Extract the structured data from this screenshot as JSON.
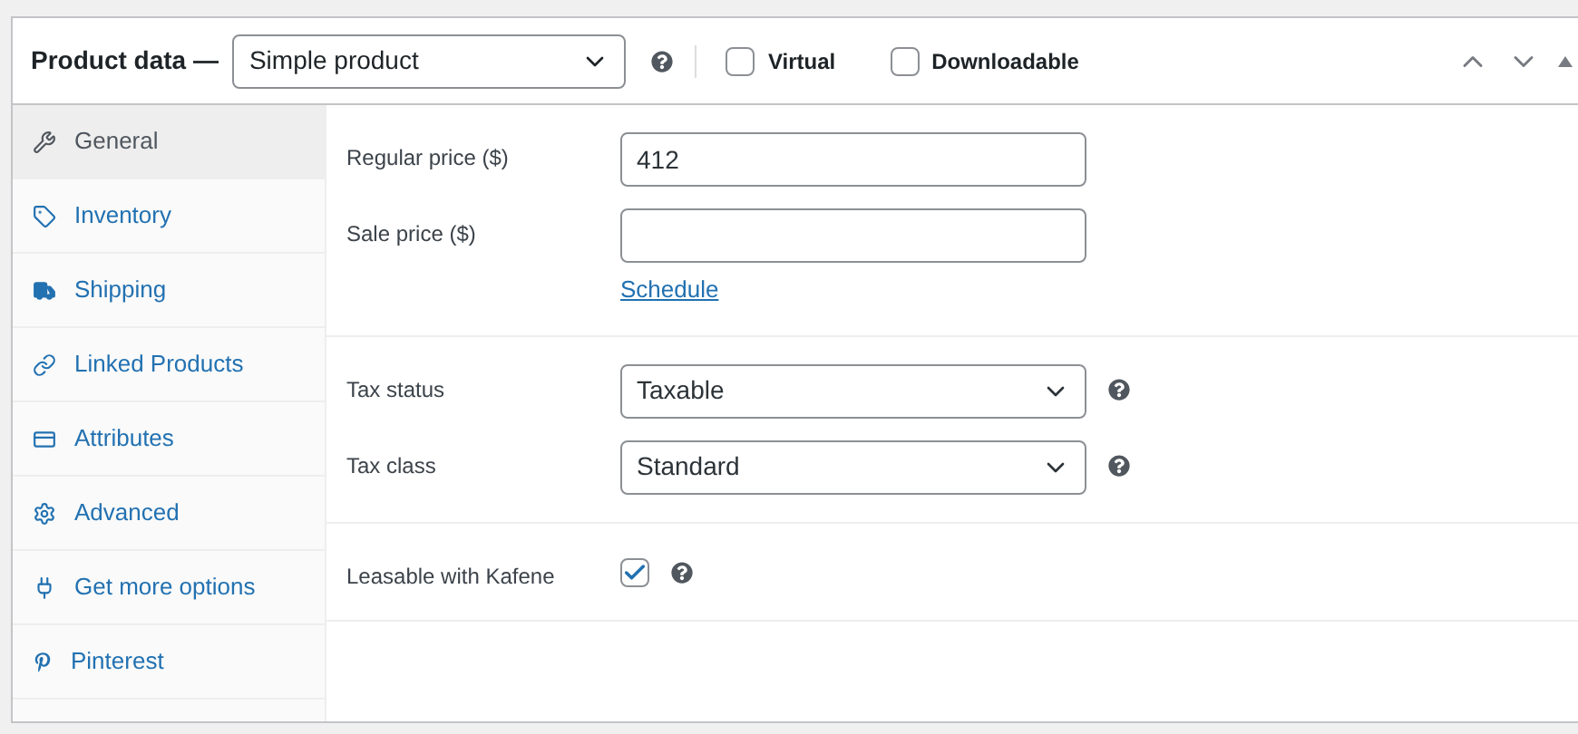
{
  "header": {
    "title": "Product data —",
    "product_type": "Simple product",
    "virtual": {
      "label": "Virtual",
      "checked": false
    },
    "downloadable": {
      "label": "Downloadable",
      "checked": false
    }
  },
  "tabs": [
    {
      "label": "General",
      "selected": true
    },
    {
      "label": "Inventory",
      "selected": false
    },
    {
      "label": "Shipping",
      "selected": false
    },
    {
      "label": "Linked Products",
      "selected": false
    },
    {
      "label": "Attributes",
      "selected": false
    },
    {
      "label": "Advanced",
      "selected": false
    },
    {
      "label": "Get more options",
      "selected": false
    },
    {
      "label": "Pinterest",
      "selected": false
    }
  ],
  "groups": [
    {
      "fields": [
        {
          "kind": "text",
          "label": "Regular price ($)",
          "value": "412"
        },
        {
          "kind": "text",
          "label": "Sale price ($)",
          "link": "Schedule"
        }
      ]
    },
    {
      "fields": [
        {
          "kind": "select",
          "label": "Tax status",
          "value": "Taxable",
          "help": true
        },
        {
          "kind": "select",
          "label": "Tax class",
          "value": "Standard",
          "help": true
        }
      ]
    },
    {
      "fields": [
        {
          "kind": "checkbox",
          "label": "Leasable with Kafene",
          "checked": true,
          "help": true
        }
      ]
    }
  ]
}
